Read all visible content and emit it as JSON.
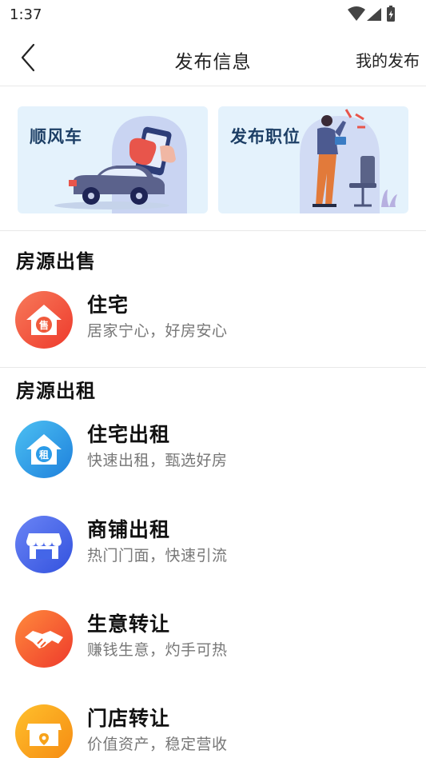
{
  "status_bar": {
    "time": "1:37"
  },
  "header": {
    "title": "发布信息",
    "my_posts": "我的发布"
  },
  "banners": [
    {
      "label": "顺风车",
      "icon": "car-illustration-icon"
    },
    {
      "label": "发布职位",
      "icon": "recruiter-illustration-icon"
    }
  ],
  "sections": [
    {
      "title": "房源出售",
      "items": [
        {
          "title": "住宅",
          "subtitle": "居家宁心，好房安心",
          "badge": "售",
          "icon": "house-sale-icon",
          "color": "#f05a3c"
        }
      ]
    },
    {
      "title": "房源出租",
      "items": [
        {
          "title": "住宅出租",
          "subtitle": "快速出租，甄选好房",
          "badge": "租",
          "icon": "house-rent-icon",
          "color": "#2a9be8"
        },
        {
          "title": "商铺出租",
          "subtitle": "热门门面，快速引流",
          "icon": "storefront-icon",
          "color": "#4466e8"
        },
        {
          "title": "生意转让",
          "subtitle": "赚钱生意，灼手可热",
          "icon": "handshake-icon",
          "color": "#f35b2c"
        },
        {
          "title": "门店转让",
          "subtitle": "价值资产，稳定营收",
          "icon": "shop-location-icon",
          "color": "#f7a21a"
        }
      ]
    }
  ]
}
